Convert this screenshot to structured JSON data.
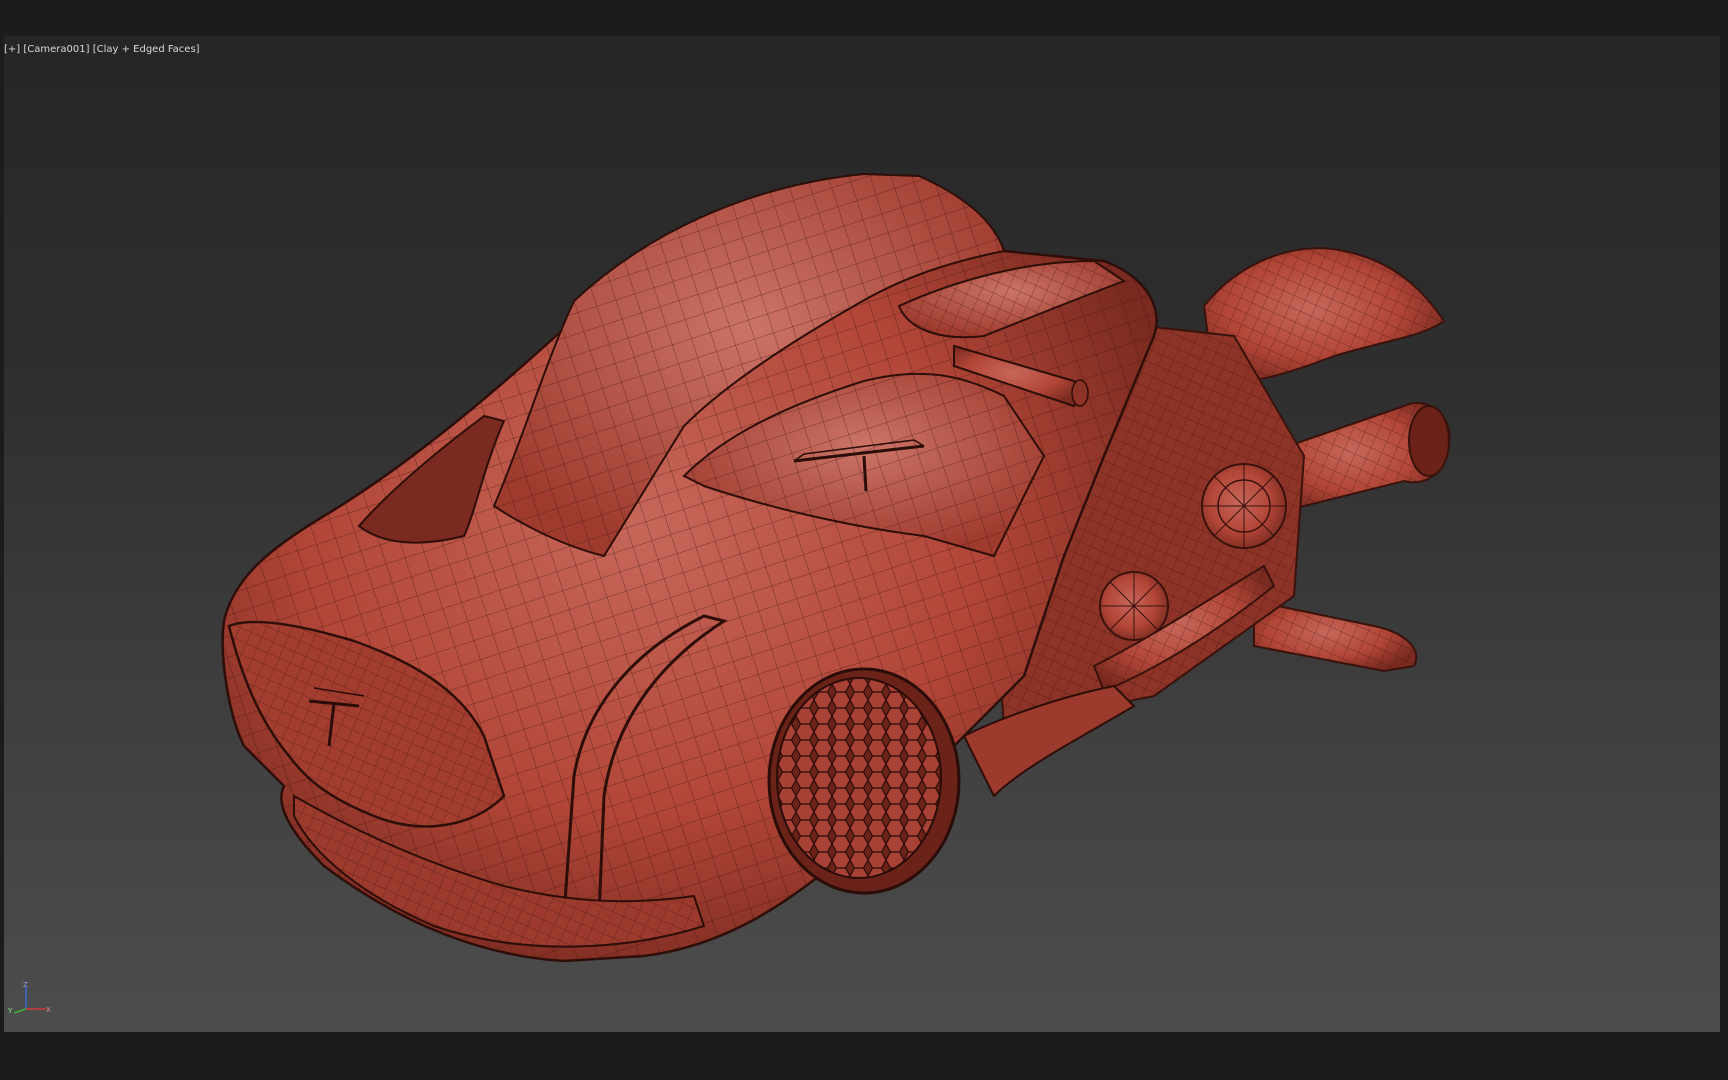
{
  "viewport": {
    "menu_label": "[+]",
    "camera_label": "[Camera001]",
    "shading_label": "[Clay + Edged Faces]"
  },
  "gizmo": {
    "z_label": "Z",
    "x_label": "X",
    "y_label": "Y"
  },
  "colors": {
    "background": "#1c1c1c",
    "clay": "#b94a3c",
    "edge": "#3a120c",
    "axis_x": "#d23a3a",
    "axis_y": "#3ab43a",
    "axis_z": "#3a6ad2"
  }
}
